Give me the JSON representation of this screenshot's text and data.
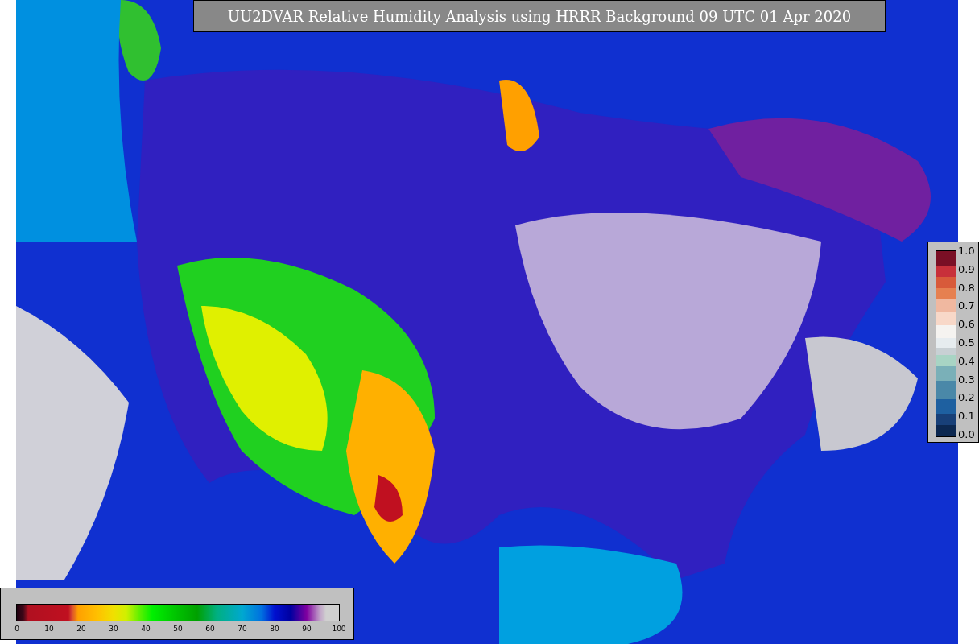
{
  "title": "UU2DVAR Relative Humidity Analysis using HRRR Background 09 UTC 01 Apr 2020",
  "observation_colorbar": {
    "ticks": [
      "1.0",
      "0.9",
      "0.8",
      "0.7",
      "0.6",
      "0.5",
      "0.4",
      "0.3",
      "0.2",
      "0.1",
      "0.0"
    ]
  },
  "humidity_colorbar": {
    "ticks": [
      "0",
      "10",
      "20",
      "30",
      "40",
      "50",
      "60",
      "70",
      "80",
      "90",
      "100"
    ]
  }
}
